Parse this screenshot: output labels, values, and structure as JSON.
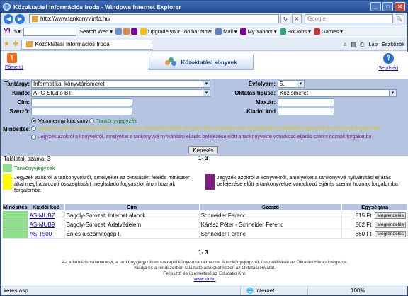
{
  "window": {
    "title": "Közoktatási Információs Iroda - Windows Internet Explorer",
    "min": "_",
    "max": "□",
    "close": "✕"
  },
  "address": {
    "url": "http://www.tankonyv.info.hu/",
    "search_placeholder": "Google",
    "back": "◀",
    "fwd": "▶",
    "refresh": "↻",
    "stop": "✕",
    "go": "→",
    "find": "🔍"
  },
  "toolbar": {
    "yahoo": "Y!",
    "search_web": "Search Web",
    "upgrade": "Upgrade your Toolbar Now!",
    "mail": "Mail",
    "myyahoo": "My Yahoo!",
    "hotjobs": "HotJobs",
    "games": "Games"
  },
  "tab": {
    "label": "Közoktatási Információs Iroda",
    "page": "Lap",
    "tools": "Eszközök"
  },
  "header": {
    "exit_label": "Főmenü",
    "title": "Közoktatási könyvek",
    "help_label": "Segítség"
  },
  "form": {
    "tantargy_label": "Tantárgy:",
    "tantargy_value": "Informatika, könyvtárismeret",
    "kiado_label": "Kiadó:",
    "kiado_value": "APC-Stúdió BT.",
    "cim_label": "Cím:",
    "szerzo_label": "Szerző:",
    "evfolyam_label": "Évfolyam:",
    "evfolyam_value": "5.",
    "oktatas_label": "Oktatás típusa:",
    "oktatas_value": "Közismeret",
    "maxar_label": "Max.ár:",
    "kiadokod_label": "Kiadói kód",
    "minosites_label": "Minősítés:",
    "radio_all": "Valamennyi kiadvány",
    "radio_tk": "Tankönyvjegyzék",
    "radio_j1": "Jegyzék azokról a tankönyvekről, amelyeket az oktatásért felelős miniszter által meghatározott összeghatárt meghaladó fogyasztói áron hoznak forgalomba",
    "radio_j2": "Jegyzék azokról a könyvekről, amelyeket a tankönyvvé nyilvánítási eljárás befejezése előtt a tankönyvekre vonatkozó eljárás szerint hoznak forgalomba",
    "search_button": "Keresés"
  },
  "results": {
    "count_text": "Találatok száma: 3",
    "pages_top": "1- 3",
    "pages_bottom": "1- 3",
    "legend_tk": "Tankönyvjegyzék",
    "legend_j1": "Jegyzék azokról a tankönyvekről, amelyeket az oktatásért felelős miniszter által meghatározott összeghatárt meghaladó fogyasztói áron hoznak forgalomba",
    "legend_j2": "Jegyzék azokról a könyvekről, amelyeket a tankönyvvé nyilvánítási eljárás befejezése előtt a tankönyvekre vonatkozó eljárás szerint hoznak forgalomba",
    "columns": {
      "minosites": "Minősítés",
      "kod": "Kiadói kód",
      "cim": "Cím",
      "szerzo": "Szerző",
      "ar": "Egységára"
    },
    "rows": [
      {
        "code": "AS-MUB7",
        "title": "Bagoly-Sorozat: Internet alapok",
        "author": "Schneider Ferenc",
        "price": "515 Ft",
        "order": "Megrendelés"
      },
      {
        "code": "AS-MUB9",
        "title": "Bagoly-Sorozat: Adatvédelem",
        "author": "Kárász Péter - Schneider Ferenc",
        "price": "562 Ft",
        "order": "Megrendelés"
      },
      {
        "code": "AS-T500",
        "title": "Én és a számítógép I.",
        "author": "Schneider Ferenc",
        "price": "660 Ft",
        "order": "Megrendelés"
      }
    ]
  },
  "footer": {
    "l1": "Az adatbázis valamennyi, a tankönyvjegyzéken szereplő könyvet tartalmazza. A tankönyvjegyzék összeállítását az Oktatási Hivatal végezte.",
    "l2": "Kiadja és a rendszerben található adatokat kezeli az Oktatási Hivatal.",
    "l3": "Fejlesztő és üzemeltető az Educatio Kht.",
    "link": "www.kir.hu"
  },
  "status": {
    "left": "keres.asp",
    "zone": "Internet",
    "zoom": "100%"
  },
  "colors": {
    "green": "#8ee08a",
    "yellow": "#ffff00",
    "purple": "#7f1f7f",
    "form_bg": "#b5c4e1"
  }
}
